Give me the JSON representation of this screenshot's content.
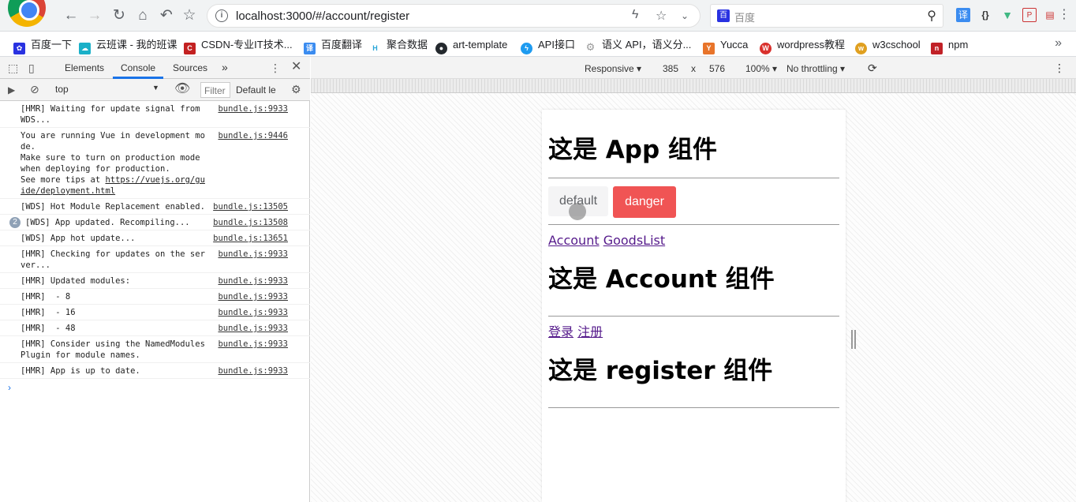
{
  "browser": {
    "url": "localhost:3000/#/account/register",
    "search_placeholder": "百度",
    "search_engine_badge": "百",
    "nav": {
      "back": "←",
      "forward": "→",
      "reload": "↻",
      "home": "⌂",
      "undo": "↶",
      "bookmark": "☆"
    }
  },
  "bookmarks": [
    {
      "label": "百度一下",
      "icon": "paw-icon",
      "color": "#2932e1"
    },
    {
      "label": "云班课 - 我的班课",
      "icon": "cloud-icon",
      "color": "#1ab0c8"
    },
    {
      "label": "CSDN-专业IT技术...",
      "icon": "csdn-icon",
      "color": "#c32121"
    },
    {
      "label": "百度翻译",
      "icon": "translate-icon",
      "color": "#3b8cf0"
    },
    {
      "label": "聚合数据",
      "icon": "juhe-icon",
      "color": "#2aa6d8"
    },
    {
      "label": "art-template",
      "icon": "github-icon",
      "color": "#24292e"
    },
    {
      "label": "API接口",
      "icon": "bolt-icon",
      "color": "#1e9bf0"
    },
    {
      "label": "语义 API，语义分...",
      "icon": "gear-icon",
      "color": "#999999"
    },
    {
      "label": "Yucca",
      "icon": "yucca-icon",
      "color": "#e8742a"
    },
    {
      "label": "wordpress教程",
      "icon": "wordpress-icon",
      "color": "#d9302c"
    },
    {
      "label": "w3cschool",
      "icon": "w3cschool-icon",
      "color": "#e0a020"
    },
    {
      "label": "npm",
      "icon": "npm-icon",
      "color": "#c12127"
    }
  ],
  "devtools": {
    "tabs": [
      "Elements",
      "Console",
      "Sources"
    ],
    "more_tabs": "»",
    "context": "top",
    "filter_placeholder": "Filter",
    "levels": "Default le",
    "messages": [
      {
        "text": "[HMR] Waiting for update signal from WDS...",
        "source": "bundle.js:9933"
      },
      {
        "text": "You are running Vue in development mode.\nMake sure to turn on production mode when deploying for production.\nSee more tips at ",
        "link": "https://vuejs.org/guide/deployment.html",
        "source": "bundle.js:9446"
      },
      {
        "text": "[WDS] Hot Module Replacement enabled.",
        "source": "bundle.js:13505"
      },
      {
        "text": "[WDS] App updated. Recompiling...",
        "source": "bundle.js:13508",
        "repeat": "2"
      },
      {
        "text": "[WDS] App hot update...",
        "source": "bundle.js:13651"
      },
      {
        "text": "[HMR] Checking for updates on the server...",
        "source": "bundle.js:9933"
      },
      {
        "text": "[HMR] Updated modules:",
        "source": "bundle.js:9933"
      },
      {
        "text": "[HMR]  - 8",
        "source": "bundle.js:9933"
      },
      {
        "text": "[HMR]  - 16",
        "source": "bundle.js:9933"
      },
      {
        "text": "[HMR]  - 48",
        "source": "bundle.js:9933"
      },
      {
        "text": "[HMR] Consider using the NamedModulesPlugin for module names.",
        "source": "bundle.js:9933"
      },
      {
        "text": "[HMR] App is up to date.",
        "source": "bundle.js:9933"
      }
    ],
    "prompt": "›"
  },
  "device": {
    "mode": "Responsive",
    "width": "385",
    "times": "x",
    "height": "576",
    "zoom": "100%",
    "throttling": "No throttling"
  },
  "app": {
    "app_title": "这是 App 组件",
    "btn_default": "default",
    "btn_danger": "danger",
    "link_account": "Account",
    "link_goods": "GoodsList",
    "account_title": "这是 Account 组件",
    "link_login": "登录",
    "link_register": "注册",
    "register_title": "这是 register 组件",
    "danger_color": "#f05454"
  }
}
